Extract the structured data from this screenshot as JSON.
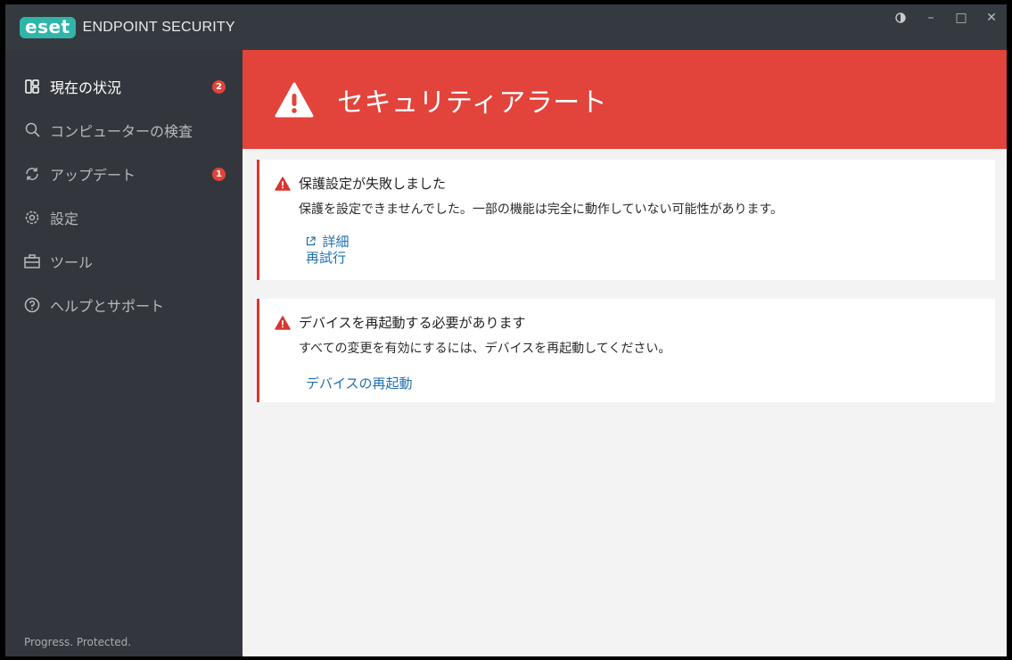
{
  "app": {
    "logo_text": "eset",
    "title": "ENDPOINT SECURITY",
    "brand_color": "#2fb5a9"
  },
  "window_controls": {
    "theme_icon": "half-circle-icon",
    "minimize": "–",
    "maximize": "□",
    "close": "✕"
  },
  "sidebar": {
    "items": [
      {
        "label": "現在の状況",
        "icon": "dashboard-icon",
        "badge": "2",
        "active": true
      },
      {
        "label": "コンピューターの検査",
        "icon": "search-icon"
      },
      {
        "label": "アップデート",
        "icon": "refresh-icon",
        "badge": "1"
      },
      {
        "label": "設定",
        "icon": "gear-icon"
      },
      {
        "label": "ツール",
        "icon": "briefcase-icon"
      },
      {
        "label": "ヘルプとサポート",
        "icon": "help-icon"
      }
    ],
    "footer": "Progress. Protected."
  },
  "banner": {
    "title": "セキュリティアラート",
    "icon": "warning-icon",
    "color": "#e2433b"
  },
  "alerts": [
    {
      "title": "保護設定が失敗しました",
      "description": "保護を設定できませんでした。一部の機能は完全に動作していない可能性があります。",
      "link_details": "詳細",
      "link_retry": "再試行"
    },
    {
      "title": "デバイスを再起動する必要があります",
      "description": "すべての変更を有効にするには、デバイスを再起動してください。",
      "link_restart": "デバイスの再起動"
    }
  ]
}
